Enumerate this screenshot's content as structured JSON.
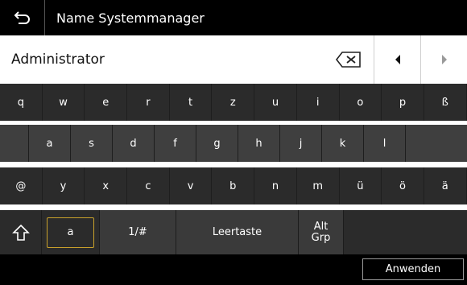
{
  "header": {
    "title": "Name Systemmanager"
  },
  "input": {
    "value": "Administrator"
  },
  "icons": {
    "back": "back-arrow-icon",
    "delete": "backspace-icon",
    "left": "cursor-left-icon",
    "right": "cursor-right-icon",
    "shift": "shift-icon"
  },
  "keyboard": {
    "row1": [
      "q",
      "w",
      "e",
      "r",
      "t",
      "z",
      "u",
      "i",
      "o",
      "p",
      "ß"
    ],
    "row2": [
      "a",
      "s",
      "d",
      "f",
      "g",
      "h",
      "j",
      "k",
      "l"
    ],
    "row3": [
      "@",
      "y",
      "x",
      "c",
      "v",
      "b",
      "n",
      "m",
      "ü",
      "ö",
      "ä"
    ]
  },
  "controls": {
    "mode_lower": "a",
    "mode_symbols": "1/#",
    "space": "Leertaste",
    "altgr_line1": "Alt",
    "altgr_line2": "Grp"
  },
  "footer": {
    "apply": "Anwenden"
  },
  "colors": {
    "highlight": "#c9a12b",
    "keyboard_bg": "#2b2b2b",
    "header_bg": "#000000"
  }
}
